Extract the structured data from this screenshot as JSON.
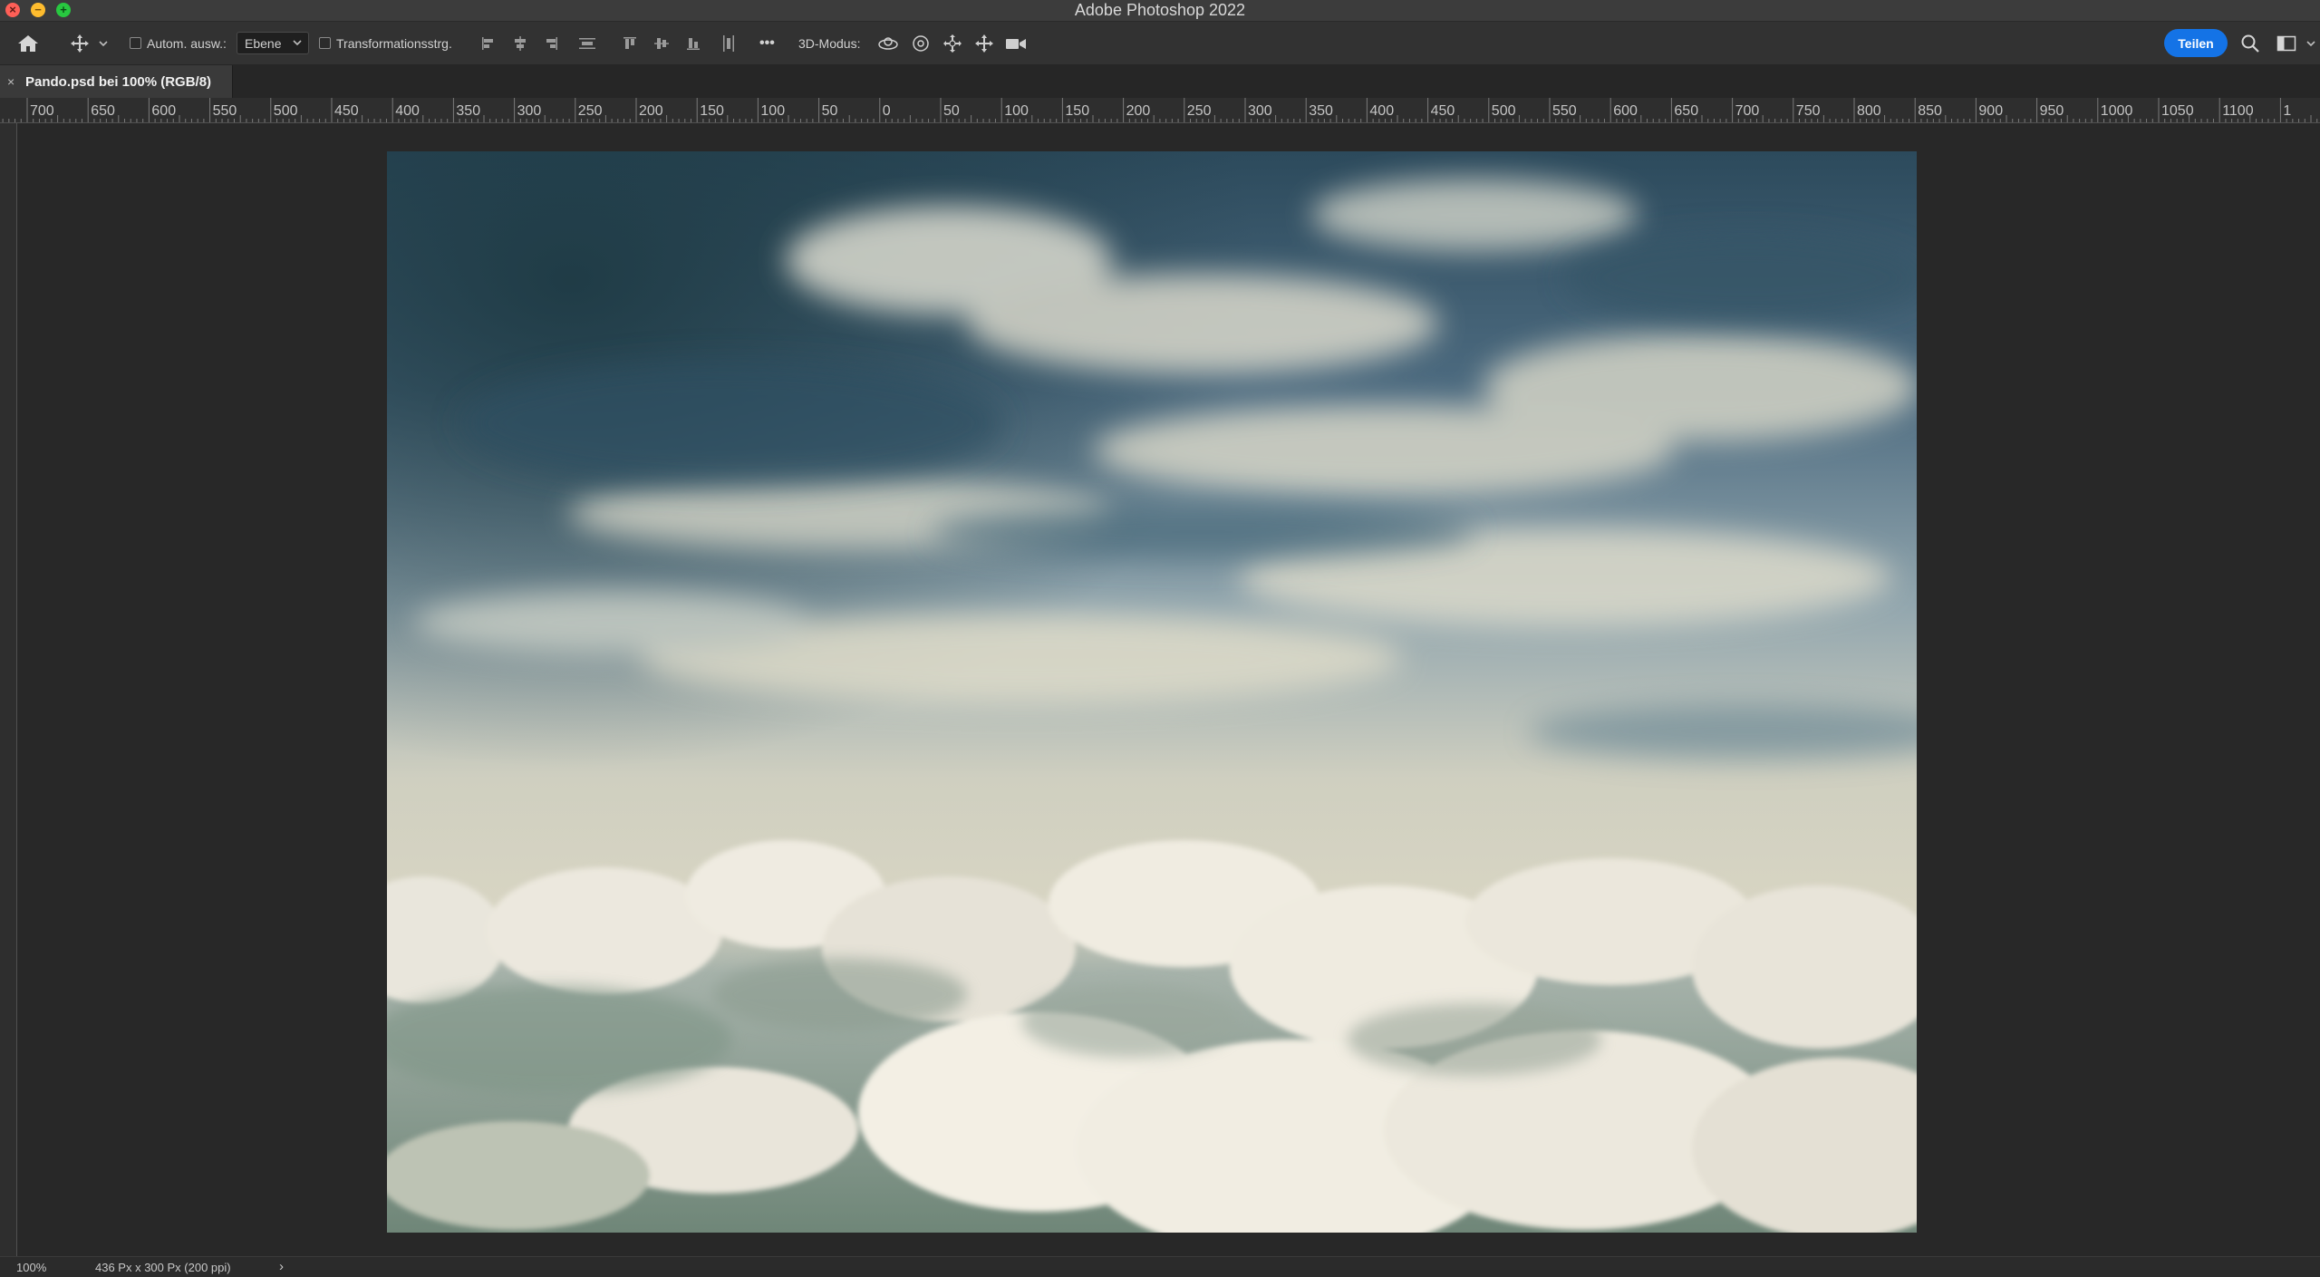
{
  "window": {
    "title": "Adobe Photoshop 2022"
  },
  "options_bar": {
    "auto_select_label": "Autom. ausw.:",
    "auto_select_value": "Ebene",
    "transform_label": "Transformationsstrg.",
    "mode_3d_label": "3D-Modus:",
    "more_label": "•••",
    "share_label": "Teilen"
  },
  "document": {
    "tab_title": "Pando.psd bei 100% (RGB/8)",
    "close_glyph": "×"
  },
  "ruler": {
    "labels": [
      "700",
      "650",
      "600",
      "550",
      "500",
      "450",
      "400",
      "350",
      "300",
      "250",
      "200",
      "150",
      "100",
      "50",
      "0",
      "50",
      "100",
      "150",
      "200",
      "250",
      "300",
      "350",
      "400",
      "450",
      "500",
      "550",
      "600",
      "650",
      "700",
      "750",
      "800",
      "850",
      "900",
      "950",
      "1000",
      "1050",
      "1100",
      "1"
    ]
  },
  "status_bar": {
    "zoom": "100%",
    "doc_info": "436 Px x 300 Px (200 ppi)",
    "arrow": "›"
  },
  "colors": {
    "accent": "#1473e6",
    "workspace": "#282828",
    "panel": "#323232"
  }
}
